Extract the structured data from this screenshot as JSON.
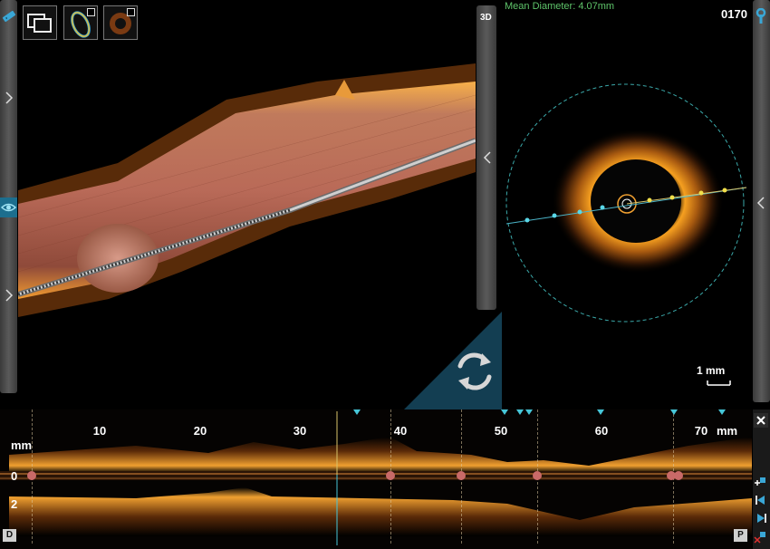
{
  "header": {
    "mean_diameter_label": "Mean Diameter:",
    "mean_diameter_value": "4.07mm",
    "frame_number": "0170",
    "view_3d_label": "3D"
  },
  "cross_section": {
    "scale_bar_label": "1 mm"
  },
  "longitudinal": {
    "ruler_ticks": [
      "10",
      "20",
      "30",
      "40",
      "50",
      "60",
      "70"
    ],
    "units_label": "mm",
    "y_unit_label": "mm",
    "y_ticks": [
      "0",
      "2"
    ],
    "distal_label": "D",
    "proximal_label": "P"
  },
  "colors": {
    "accent_cyan": "#46c6d8",
    "measure_green": "#5ec46a",
    "lumen_marker": "#c96a68",
    "frame_line": "#d9c46a"
  },
  "icons": [
    "ruler-icon",
    "eye-icon",
    "wrench-icon",
    "rotate-icon",
    "layout-icon",
    "ring-view-icon",
    "crosssection-view-icon",
    "close-icon"
  ]
}
